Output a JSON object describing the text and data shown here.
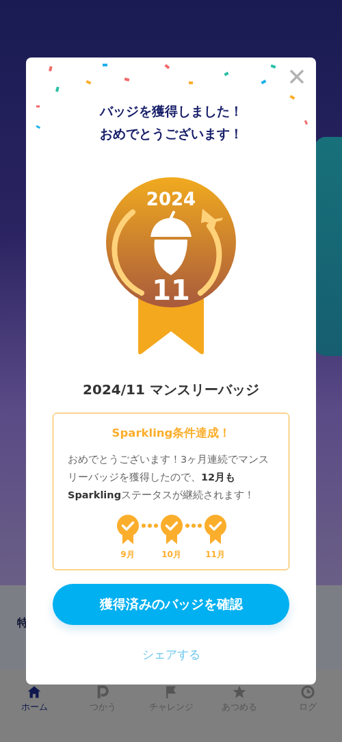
{
  "background": {
    "section_heading": "特"
  },
  "modal": {
    "title_lines": [
      "バッジを獲得しました！",
      "おめでとうございます！"
    ],
    "badge": {
      "year": "2024",
      "month": "11"
    },
    "badge_name": "2024/11 マンスリーバッジ",
    "achievement": {
      "heading": "Sparkling条件達成！",
      "message": "おめでとうございます！3ヶ月連続でマンスリーバッジを獲得したので、**12月も Sparkling**ステータスが継続されます！",
      "months": [
        {
          "label": "9月",
          "achieved": true
        },
        {
          "label": "10月",
          "achieved": true
        },
        {
          "label": "11月",
          "achieved": true
        }
      ]
    },
    "primary_button": "獲得済みのバッジを確認",
    "share_link": "シェアする"
  },
  "bottom_nav": [
    {
      "label": "ホーム",
      "kind": "home",
      "selected": true
    },
    {
      "label": "つかう",
      "kind": "points",
      "selected": false
    },
    {
      "label": "チャレンジ",
      "kind": "flag",
      "selected": false
    },
    {
      "label": "あつめる",
      "kind": "star",
      "selected": false
    },
    {
      "label": "ログ",
      "kind": "log",
      "selected": false
    }
  ]
}
